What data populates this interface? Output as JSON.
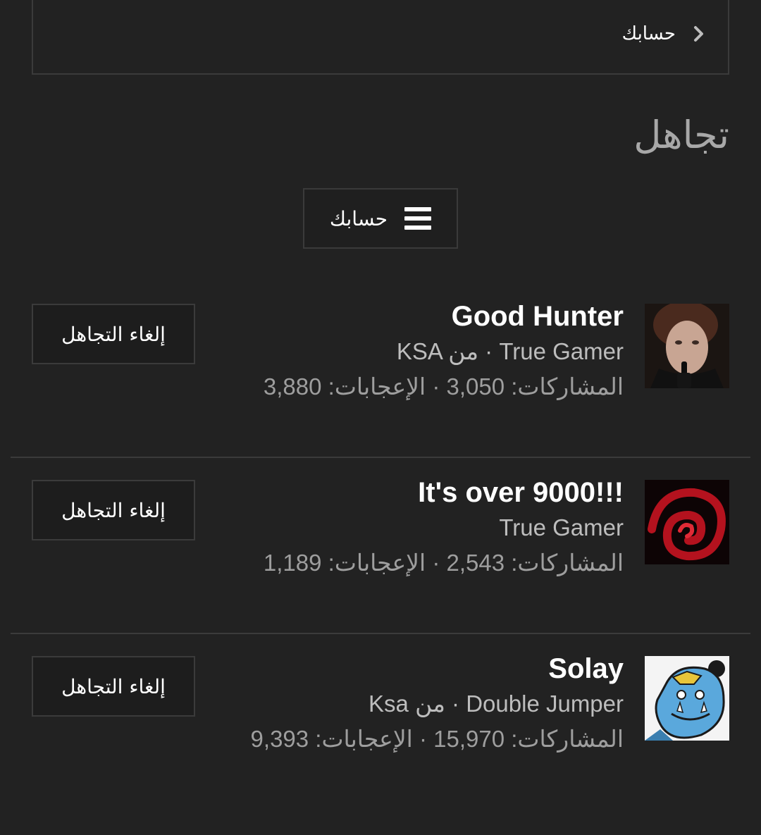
{
  "top_link": {
    "label": "حسابك",
    "icon": "chevron-right-icon"
  },
  "section": {
    "title": "تجاهل"
  },
  "menu_button": {
    "label": "حسابك",
    "icon": "menu-icon"
  },
  "users": [
    {
      "name": "Good Hunter",
      "meta": "KSA من · True Gamer",
      "stats": "المشاركات: 3,050 · الإعجابات: 3,880",
      "button_label": "إلغاء التجاهل",
      "avatar": "portrait-avatar"
    },
    {
      "name": "It's over 9000!!!",
      "meta": "True Gamer",
      "stats": "المشاركات: 2,543 · الإعجابات: 1,189",
      "button_label": "إلغاء التجاهل",
      "avatar": "red-swirl-avatar"
    },
    {
      "name": "Solay",
      "meta": "Ksa من · Double Jumper",
      "stats": "المشاركات: 15,970 · الإعجابات: 9,393",
      "button_label": "إلغاء التجاهل",
      "avatar": "cartoon-avatar"
    }
  ],
  "colors": {
    "background": "#222222",
    "border": "#3b3b3b",
    "title": "#a8a8a8",
    "meta": "#bdbdbd",
    "stats": "#9e9e9e"
  }
}
